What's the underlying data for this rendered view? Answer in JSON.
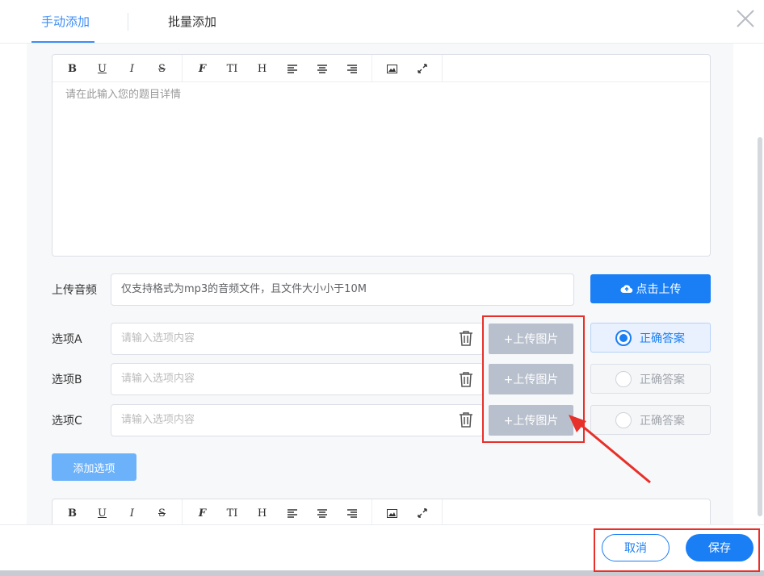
{
  "tabs": [
    {
      "label": "手动添加",
      "active": true
    },
    {
      "label": "批量添加",
      "active": false
    }
  ],
  "editor": {
    "toolbar": [
      "B",
      "U",
      "I",
      "S",
      "F",
      "TI",
      "H"
    ],
    "placeholder": "请在此输入您的题目详情"
  },
  "audio": {
    "label": "上传音频",
    "hint": "仅支持格式为mp3的音频文件，且文件大小小于10M",
    "upload_label": "点击上传"
  },
  "options": [
    {
      "label": "选项A",
      "placeholder": "请输入选项内容",
      "upload_label": "+上传图片",
      "answer_label": "正确答案",
      "correct": true
    },
    {
      "label": "选项B",
      "placeholder": "请输入选项内容",
      "upload_label": "+上传图片",
      "answer_label": "正确答案",
      "correct": false
    },
    {
      "label": "选项C",
      "placeholder": "请输入选项内容",
      "upload_label": "+上传图片",
      "answer_label": "正确答案",
      "correct": false
    }
  ],
  "add_option_label": "添加选项",
  "footer": {
    "cancel_label": "取消",
    "save_label": "保存"
  },
  "colors": {
    "primary": "#1a7ef5",
    "annotation": "#e8302a",
    "upload_image_bg": "#b9c0cd"
  }
}
